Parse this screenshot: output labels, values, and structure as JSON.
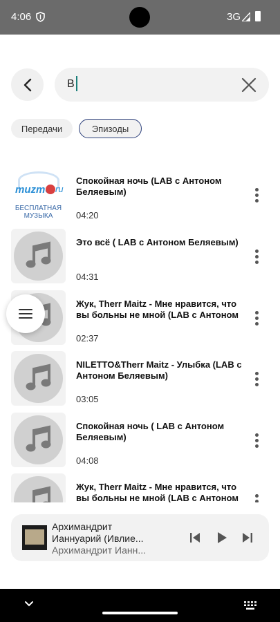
{
  "status_bar": {
    "time": "4:06",
    "network": "3G"
  },
  "search": {
    "query": "В"
  },
  "chips": [
    {
      "label": "Передачи"
    },
    {
      "label": "Эпизоды"
    }
  ],
  "items": [
    {
      "title": "Спокойная ночь (LAB с Антоном Беляевым)",
      "duration": "04:20",
      "thumb": "muzmo-logo"
    },
    {
      "title": "Это всё ( LAB с  Антоном Беляевым)",
      "duration": "04:31",
      "thumb": "music-note-icon"
    },
    {
      "title": " Жук, Therr Maitz - Мне нравится, что вы больны не мной (LAB с Антоном Б...",
      "duration": "02:37",
      "thumb": "music-note-icon"
    },
    {
      "title": "NILETTO&Therr Maitz - Улыбка (LAB с Антоном Беляевым)",
      "duration": "03:05",
      "thumb": "music-note-icon"
    },
    {
      "title": "Спокойная ночь ( LAB с Антоном Беляевым)",
      "duration": "04:08",
      "thumb": "music-note-icon"
    },
    {
      "title": " Жук, Therr Maitz - Мне нравится, что вы больны не мной (LAB с Антоном Б...",
      "duration": "",
      "thumb": "music-note-icon"
    }
  ],
  "muzmo": {
    "brand": "muzmo",
    "domain": "ru",
    "caption": "БЕСПЛАТНАЯ МУЗЫКА"
  },
  "player": {
    "title": "Архимандрит Ианнуарий (Ивлие...",
    "artist": "Архимандрит Ианн..."
  },
  "colors": {
    "accent": "#2b3f7a",
    "caret": "#1b7f7a",
    "status_bar": "#6b6b6b"
  }
}
